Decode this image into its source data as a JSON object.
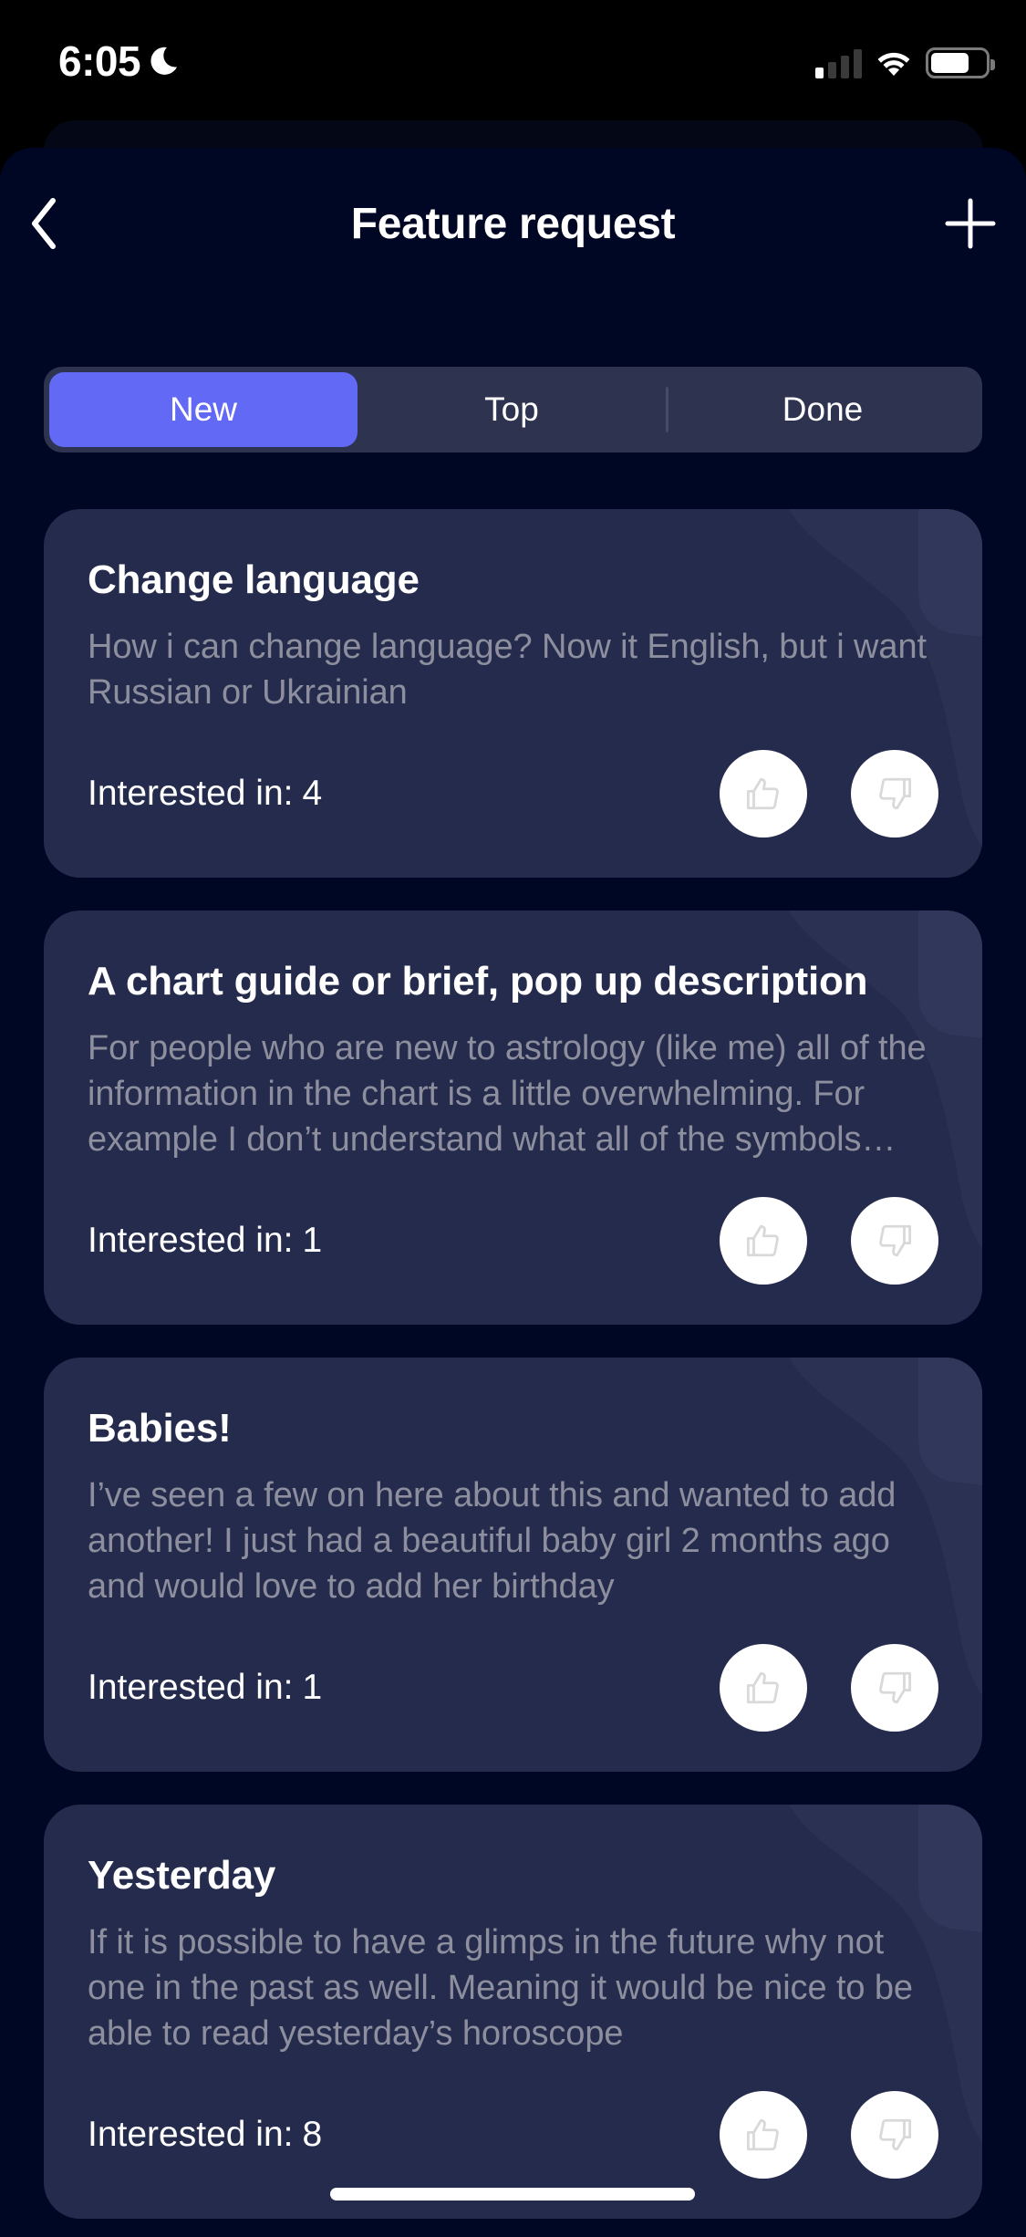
{
  "status_bar": {
    "time": "6:05",
    "focus_icon": "moon-icon",
    "signal_bars_active": 1,
    "signal_bars_total": 4,
    "wifi_icon": "wifi-icon",
    "battery_level": 0.7
  },
  "nav": {
    "title": "Feature request",
    "back_icon": "chevron-left-icon",
    "add_icon": "plus-icon"
  },
  "tabs": {
    "selected": "New",
    "items": [
      {
        "label": "New",
        "active": true
      },
      {
        "label": "Top",
        "active": false
      },
      {
        "label": "Done",
        "active": false
      }
    ]
  },
  "colors": {
    "background": "#000724",
    "card": "#252b4c",
    "accent": "#6169f5",
    "segmented_bg": "#2e3350",
    "description_text": "#8e8f9e"
  },
  "interest_label": "Interested in:",
  "requests": [
    {
      "title": "Change language",
      "description": "How i can change language? Now it English, but i want Russian or Ukrainian",
      "interested": "4"
    },
    {
      "title": "A chart guide or brief, pop up description",
      "description": "For people who are new to astrology (like me) all of the information in the chart is a little overwhelming. For example I don’t understand what all of the symbols mean",
      "interested": "1"
    },
    {
      "title": "Babies!",
      "description": "I’ve seen a few on here about this and wanted to add another! I just had a beautiful baby girl 2 months ago and would love to add her birthday",
      "interested": "1"
    },
    {
      "title": "Yesterday",
      "description": "If it is possible to have a glimps in the future why not one in the past as well. Meaning it would be nice to be able to read yesterday’s horoscope",
      "interested": "8"
    }
  ],
  "vote_icons": {
    "upvote": "thumbs-up-icon",
    "downvote": "thumbs-down-icon"
  }
}
